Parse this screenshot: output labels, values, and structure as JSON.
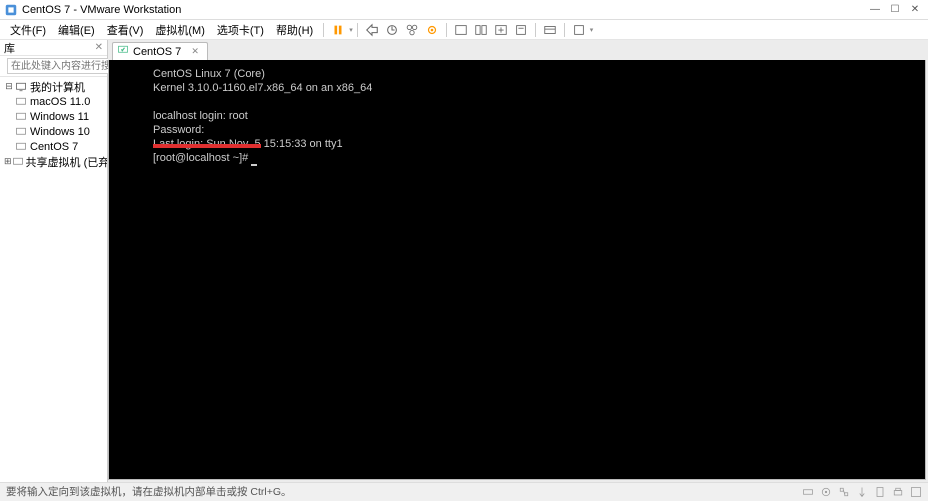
{
  "window": {
    "title": "CentOS 7 - VMware Workstation",
    "min": "—",
    "max": "☐",
    "close": "✕"
  },
  "menu": {
    "file": "文件(F)",
    "edit": "编辑(E)",
    "view": "查看(V)",
    "vm": "虚拟机(M)",
    "tabs": "选项卡(T)",
    "help": "帮助(H)"
  },
  "sidebar": {
    "header": "库",
    "close": "✕",
    "search_placeholder": "在此处键入内容进行搜索",
    "root": "我的计算机",
    "items": [
      {
        "label": "macOS 11.0"
      },
      {
        "label": "Windows 11"
      },
      {
        "label": "Windows 10"
      },
      {
        "label": "CentOS 7"
      }
    ],
    "shared": "共享虚拟机 (已弃用)"
  },
  "tab": {
    "label": "CentOS 7",
    "close": "✕"
  },
  "console": {
    "line1": "CentOS Linux 7 (Core)",
    "line2": "Kernel 3.10.0-1160.el7.x86_64 on an x86_64",
    "line3": "",
    "line4": "localhost login: root",
    "line5": "Password:",
    "line6": "Last login: Sun Nov  5 15:15:33 on tty1",
    "line7_prompt": "[root@localhost ~]# "
  },
  "status": {
    "text": "要将输入定向到该虚拟机，请在虚拟机内部单击或按 Ctrl+G。"
  }
}
